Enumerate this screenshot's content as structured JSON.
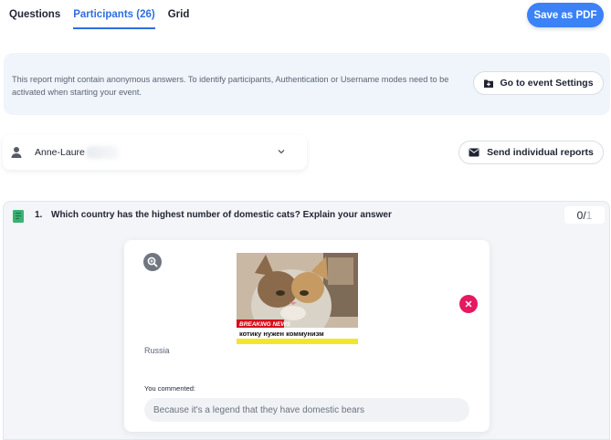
{
  "tabs": [
    {
      "label": "Questions"
    },
    {
      "label": "Participants (26)"
    },
    {
      "label": "Grid"
    }
  ],
  "header": {
    "save_pdf_label": "Save as PDF"
  },
  "notice": {
    "text": "This report might contain anonymous answers. To identify participants, Authentication or Username modes need to be activated when starting your event.",
    "settings_button": "Go to event Settings"
  },
  "participant": {
    "name": "Anne-Laure"
  },
  "send_reports_label": "Send individual reports",
  "question": {
    "number": "1.",
    "text": "Which country has the highest number of domestic cats? Explain your answer",
    "score_value": "0/",
    "score_total": "1"
  },
  "answer": {
    "image_banner": "BREAKING NEWS",
    "image_caption": "котику нужен коммунизм",
    "label": "Russia",
    "comment_label": "You commented:",
    "comment": "Because it's a legend that they have domestic bears"
  },
  "colors": {
    "accent": "#2f6fe0",
    "primary_button": "#3b82f6",
    "remove": "#e5195f",
    "question_icon": "#3bb273"
  }
}
